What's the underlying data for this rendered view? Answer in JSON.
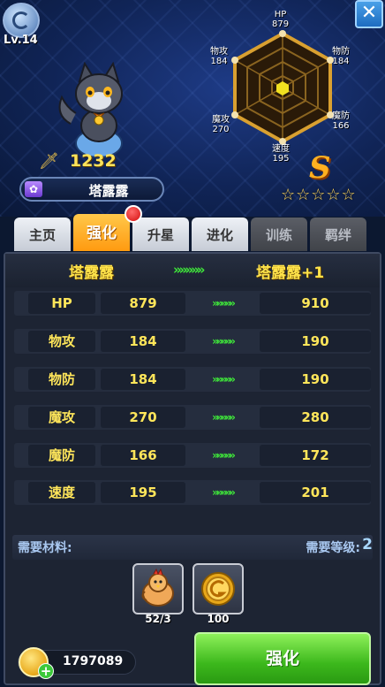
{
  "player": {
    "level": "Lv.14"
  },
  "hero": {
    "name": "塔露露",
    "power": "1232",
    "rank": "S",
    "stars": "☆☆☆☆☆"
  },
  "radar_labels": [
    {
      "name": "HP",
      "value": "879"
    },
    {
      "name": "物防",
      "value": "184"
    },
    {
      "name": "魔防",
      "value": "166"
    },
    {
      "name": "速度",
      "value": "195"
    },
    {
      "name": "魔攻",
      "value": "270"
    },
    {
      "name": "物攻",
      "value": "184"
    }
  ],
  "tabs": [
    "主页",
    "强化",
    "升星",
    "进化",
    "训练",
    "羁绊"
  ],
  "compare": {
    "current_name": "塔露露",
    "arrows": "»»»»»",
    "next_name": "塔露露+1"
  },
  "stats": [
    {
      "label": "HP",
      "current": "879",
      "next": "910"
    },
    {
      "label": "物攻",
      "current": "184",
      "next": "190"
    },
    {
      "label": "物防",
      "current": "184",
      "next": "190"
    },
    {
      "label": "魔攻",
      "current": "270",
      "next": "280"
    },
    {
      "label": "魔防",
      "current": "166",
      "next": "172"
    },
    {
      "label": "速度",
      "current": "195",
      "next": "201"
    }
  ],
  "row_arrows": "»»»»»",
  "materials": {
    "label": "需要材料:",
    "level_label": "需要等级:",
    "level_value": "2",
    "items": [
      {
        "icon": "chicken-icon",
        "count": "52/3"
      },
      {
        "icon": "coin-icon",
        "count": "100"
      }
    ]
  },
  "gold": "1797089",
  "enhance_button": "强化",
  "close_label": "✕",
  "colors": {
    "gold_text": "#ffe65a",
    "arrow_green": "#3fe83a",
    "active_tab": "#ff9a10",
    "button_green": "#3cb81c"
  }
}
